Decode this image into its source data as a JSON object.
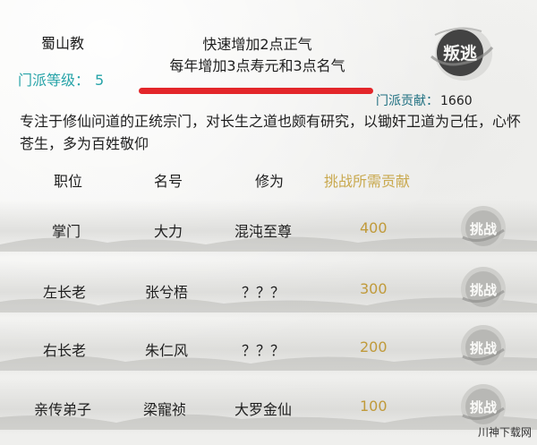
{
  "sect": {
    "name": "蜀山教",
    "level_label": "门派等级：",
    "level_value": "5"
  },
  "notice": {
    "line1": "快速增加2点正气",
    "line2": "每年增加3点寿元和3点名气"
  },
  "defect_button": {
    "label": "叛逃"
  },
  "contribution": {
    "label": "门派贡献：",
    "value": "1660"
  },
  "description": "专注于修仙问道的正统宗门，对长生之道也颇有研究，以锄奸卫道为己任，心怀苍生，多为百姓敬仰",
  "table": {
    "headers": {
      "position": "职位",
      "name": "名号",
      "cultivation": "修为",
      "cost": "挑战所需贡献"
    },
    "challenge_label": "挑战",
    "rows": [
      {
        "position": "掌门",
        "name": "大力",
        "cultivation": "混沌至尊",
        "cost": "400"
      },
      {
        "position": "左长老",
        "name": "张兮梧",
        "cultivation": "？？？",
        "cost": "300"
      },
      {
        "position": "右长老",
        "name": "朱仁风",
        "cultivation": "？？？",
        "cost": "200"
      },
      {
        "position": "亲传弟子",
        "name": "梁寵祯",
        "cultivation": "大罗金仙",
        "cost": "100"
      }
    ]
  },
  "watermark": "川神下载网",
  "colors": {
    "accent_teal": "#26a3a8",
    "cost_gold": "#c09a3a",
    "notice_bar": "#e3262a"
  }
}
